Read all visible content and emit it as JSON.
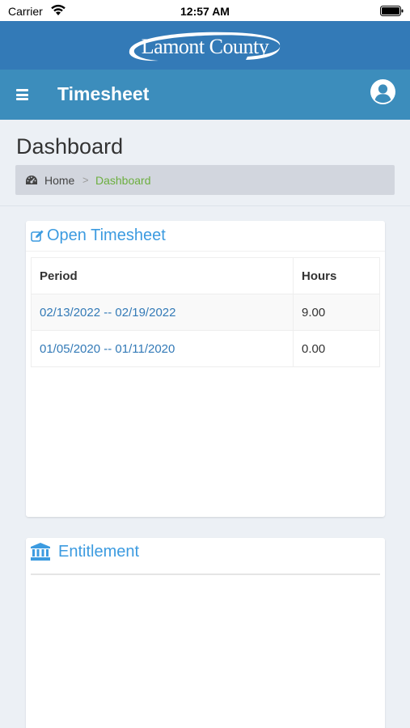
{
  "status_bar": {
    "carrier": "Carrier",
    "time": "12:57 AM"
  },
  "brand": {
    "logo_text": "Lamont County"
  },
  "app_bar": {
    "title": "Timesheet",
    "menu_icon": "hamburger-menu-icon",
    "user_icon": "user-circle-icon"
  },
  "page": {
    "title": "Dashboard"
  },
  "breadcrumb": {
    "icon": "dashboard-gauge-icon",
    "home": "Home",
    "separator": ">",
    "current": "Dashboard"
  },
  "open_timesheet": {
    "icon": "edit-icon",
    "title": "Open Timesheet",
    "columns": [
      "Period",
      "Hours"
    ],
    "rows": [
      {
        "period": "02/13/2022 -- 02/19/2022",
        "hours": "9.00"
      },
      {
        "period": "01/05/2020 -- 01/11/2020",
        "hours": "0.00"
      }
    ]
  },
  "entitlement": {
    "icon": "institution-icon",
    "title": "Entitlement"
  },
  "colors": {
    "brand_bar": "#337ab7",
    "app_bar": "#3c8dbc",
    "accent": "#3c9be0",
    "breadcrumb_active": "#6cae3f"
  }
}
